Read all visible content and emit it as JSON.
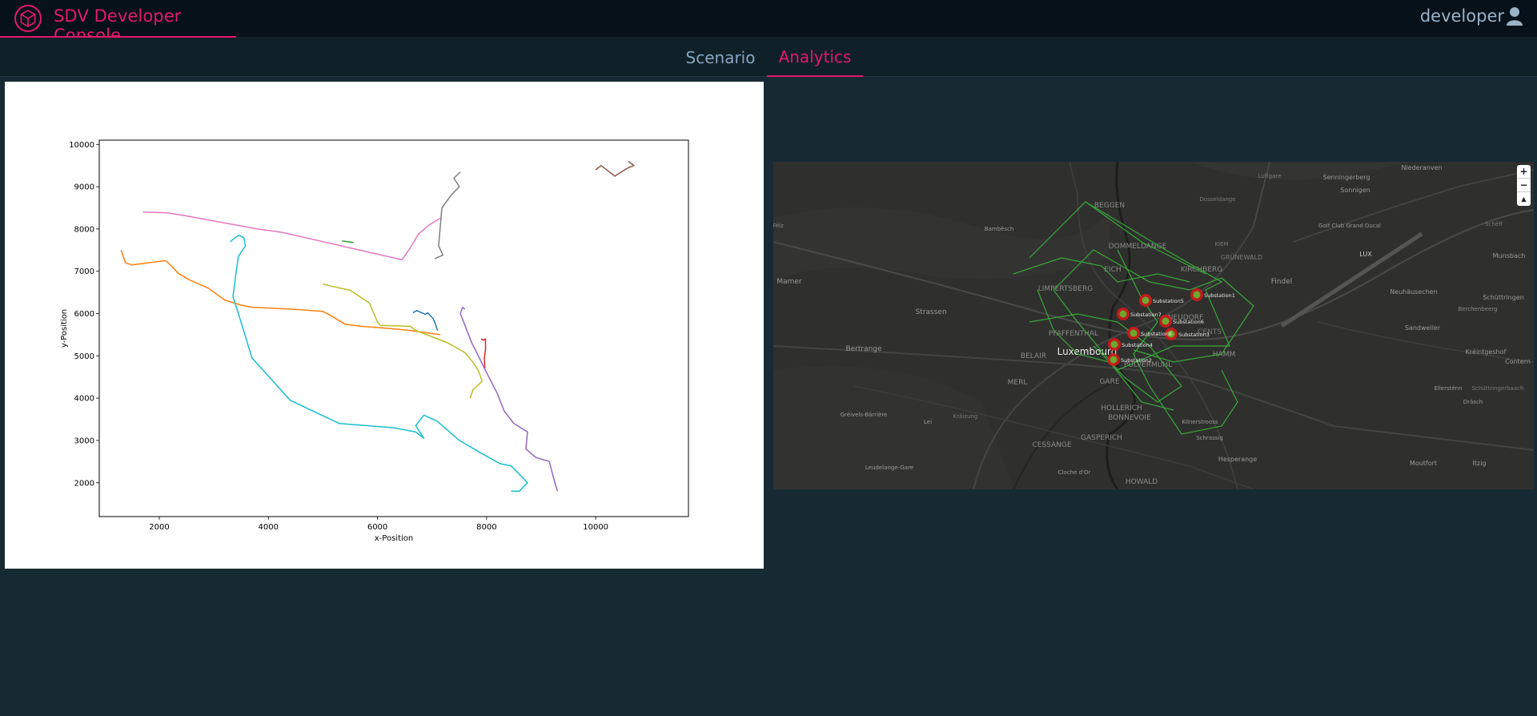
{
  "app": {
    "title": "SDV Developer Console",
    "user": "developer"
  },
  "tabs": [
    {
      "label": "Scenario",
      "active": false
    },
    {
      "label": "Analytics",
      "active": true
    }
  ],
  "colors": {
    "accent": "#e4186b",
    "header_bg": "#06111a",
    "page_bg": "#172a33",
    "map_route": "#3aa83a",
    "map_marker": "#d21a1a"
  },
  "chart_data": {
    "type": "line",
    "xlabel": "x-Position",
    "ylabel": "y-Position",
    "xlim": [
      900,
      11700
    ],
    "ylim": [
      1200,
      10100
    ],
    "x_ticks": [
      2000,
      4000,
      6000,
      8000,
      10000
    ],
    "y_ticks": [
      2000,
      3000,
      4000,
      5000,
      6000,
      7000,
      8000,
      9000,
      10000
    ],
    "grid": false,
    "series": [
      {
        "color": "#1f77b4",
        "x": [
          6650,
          6720,
          6880,
          6920,
          7020,
          7060,
          7100
        ],
        "y": [
          6020,
          6070,
          5980,
          6020,
          5880,
          5760,
          5600
        ]
      },
      {
        "color": "#ff7f0e",
        "x": [
          1300,
          1380,
          1500,
          1800,
          2100,
          2150,
          2350,
          2550,
          2900,
          3200,
          3500,
          3700,
          4500,
          5000,
          5150,
          5400,
          5700,
          6200,
          6600,
          7150
        ],
        "y": [
          7500,
          7200,
          7150,
          7200,
          7250,
          7220,
          6950,
          6800,
          6600,
          6320,
          6200,
          6150,
          6100,
          6050,
          5950,
          5750,
          5700,
          5650,
          5600,
          5500
        ]
      },
      {
        "color": "#2ca02c",
        "x": [
          5350,
          5450,
          5560
        ],
        "y": [
          7720,
          7700,
          7680
        ]
      },
      {
        "color": "#d62728",
        "x": [
          7900,
          7940,
          7980,
          7980,
          7960,
          7970
        ],
        "y": [
          5400,
          5370,
          5400,
          5150,
          4950,
          4700
        ]
      },
      {
        "color": "#9467bd",
        "x": [
          7600,
          7560,
          7520,
          7700,
          7730,
          7810,
          8000,
          8200,
          8320,
          8500,
          8750,
          8720,
          8900,
          9150,
          9230,
          9300
        ],
        "y": [
          6100,
          6150,
          6000,
          5400,
          5300,
          5100,
          4600,
          4100,
          3700,
          3400,
          3200,
          2800,
          2600,
          2500,
          2100,
          1800
        ]
      },
      {
        "color": "#8c564b",
        "x": [
          10000,
          10100,
          10350,
          10600,
          10700,
          10600
        ],
        "y": [
          9400,
          9500,
          9250,
          9450,
          9500,
          9600
        ]
      },
      {
        "color": "#e377c2",
        "x": [
          1700,
          2150,
          2450,
          3800,
          4250,
          6450,
          6600,
          6750,
          6950,
          7150
        ],
        "y": [
          8400,
          8380,
          8320,
          8000,
          7920,
          7270,
          7550,
          7880,
          8100,
          8250
        ]
      },
      {
        "color": "#7f7f7f",
        "x": [
          7050,
          7200,
          7120,
          7180,
          7350,
          7500,
          7400,
          7520
        ],
        "y": [
          7300,
          7380,
          7600,
          8500,
          8800,
          9000,
          9200,
          9350
        ]
      },
      {
        "color": "#bcbd22",
        "x": [
          5000,
          5150,
          5500,
          5850,
          6000,
          6050,
          6600,
          6700,
          7300,
          7600,
          7750,
          7850,
          7920,
          7750,
          7700
        ],
        "y": [
          6700,
          6650,
          6550,
          6250,
          5800,
          5720,
          5700,
          5600,
          5300,
          5080,
          4850,
          4650,
          4400,
          4200,
          4000
        ]
      },
      {
        "color": "#17becf",
        "x": [
          3300,
          3450,
          3550,
          3580,
          3450,
          3400,
          3350,
          3450,
          3700,
          4400,
          5300,
          6300,
          6700,
          6850,
          6700,
          6850,
          7100,
          7500,
          7900,
          8250,
          8450,
          8750,
          8600,
          8450
        ],
        "y": [
          7700,
          7850,
          7800,
          7600,
          7350,
          6900,
          6400,
          6000,
          4950,
          3950,
          3400,
          3300,
          3200,
          3050,
          3350,
          3600,
          3450,
          3000,
          2700,
          2450,
          2400,
          2000,
          1800,
          1800
        ]
      }
    ]
  },
  "map": {
    "labels": [
      "BEGGEN",
      "DOMMELDANGE",
      "KIEM",
      "GRÜNEWALD",
      "KIRCHBERG",
      "EICH",
      "LIMPERTSBERG",
      "PFAFFENTHAL",
      "NEUDORF",
      "BELAIR",
      "Luxembourg",
      "CENTS",
      "HAMM",
      "PULVERMUHL",
      "MERL",
      "GARE",
      "HOLLERICH",
      "BONNEVOIE",
      "CESSANGE",
      "GASPERICH",
      "HOWALD",
      "Strassen",
      "Bertrange",
      "Mamer",
      "Bambësch",
      "Findel",
      "Senningerberg",
      "Sonnigen",
      "Niederanven",
      "Golf Club Grand Ducal",
      "LUX",
      "Munsbach",
      "Neuhäusechen",
      "Schüttringen",
      "Sandweiler",
      "Contern",
      "Moutfort",
      "Itzig",
      "Hesperange",
      "Schrassig",
      "Kréintgeshof",
      "Ellerstënn",
      "Dräsch",
      "Gréivels-Bärrière",
      "Leudelange-Gare",
      "Cloche d'Or",
      "Kilnerstrooss",
      "Berchenbeerg",
      "Schüttringerbaach",
      "Fëlz",
      "Dosseldange",
      "Lei",
      "Luffgare",
      "Kräizung",
      "Schëff"
    ],
    "substations": [
      "Substation1",
      "Substation2",
      "Substation3",
      "Substation4",
      "Substation5",
      "Substation6",
      "Substation7",
      "Substation8"
    ],
    "controls": {
      "zoom_in": "+",
      "zoom_out": "−",
      "reset": "▲"
    }
  }
}
